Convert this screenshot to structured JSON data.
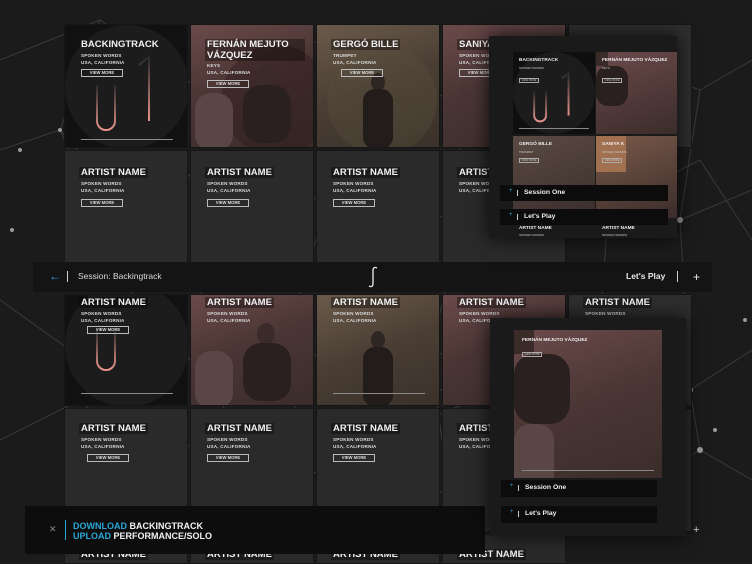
{
  "tiles": {
    "backingtrack": {
      "name": "BACKINGTRACK",
      "sub1": "SPOKEN WORDS",
      "sub2": "USA, CALIFORNIA",
      "button": "VIEW MORE"
    },
    "fernan": {
      "name": "FERNÁN MEJUTO VÁZQUEZ",
      "sub1": "KEYS",
      "sub2": "USA, CALIFORNIA",
      "button": "VIEW MORE"
    },
    "gergo": {
      "name": "GERGÓ BILLE",
      "sub1": "TRUMPET",
      "sub2": "USA, CALIFORNIA",
      "button": "VIEW MORE"
    },
    "saniya": {
      "name": "SANIYA",
      "sub1": "SPOKEN WORDS",
      "sub2": "USA, CALIFORNIA",
      "button": "VIEW MORE"
    },
    "generic": {
      "name": "ARTIST NAME",
      "sub1": "SPOKEN WORDS",
      "sub2": "USA, CALIFORNIA",
      "button": "VIEW MORE"
    }
  },
  "session_bar": {
    "back_icon": "arrow-left-icon",
    "title": "Session: Backingtrack",
    "logo_icon": "integral-logo-icon",
    "right_label": "Let's Play",
    "add_icon": "plus-icon"
  },
  "bottom_bar": {
    "close_icon": "close-icon",
    "line1_accent": "DOWNLOAD",
    "line1_text": "BACKINGTRACK",
    "line2_accent": "UPLOAD",
    "line2_text": "PERFORMANCE/SOLO"
  },
  "panel_top": {
    "tiles": [
      {
        "name": "BACKINGTRACK",
        "sub": "SPOKEN WORDS",
        "button": "VIEW MORE"
      },
      {
        "name": "FERNÁN MEJUTO VÁZQUEZ",
        "sub": "KEYS",
        "button": "VIEW MORE"
      },
      {
        "name": "GERGÓ BILLE",
        "sub": "TRUMPET",
        "button": "VIEW MORE"
      },
      {
        "name": "SANIYA K",
        "sub": "SPOKEN WORDS",
        "button": "VIEW MORE"
      },
      {
        "name": "ARTIST NAME",
        "sub": "SPOKEN WORDS",
        "button": ""
      },
      {
        "name": "ARTIST NAME",
        "sub": "SPOKEN WORDS",
        "button": ""
      }
    ],
    "session_one": "Session One",
    "lets_play": "Let's Play"
  },
  "panel_bottom": {
    "tile": {
      "name": "FERNÁN MEJUTO VÁZQUEZ",
      "button": "VIEW MORE"
    },
    "session_one": "Session One",
    "lets_play": "Let's Play"
  },
  "colors": {
    "accent": "#2aa7d8",
    "background": "#1b1b1b",
    "bar": "#141414",
    "logo_gradient": "#e8948a"
  }
}
